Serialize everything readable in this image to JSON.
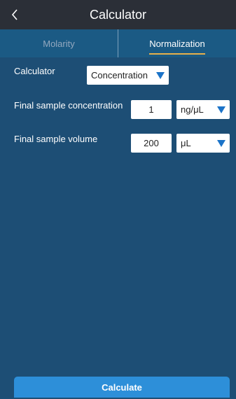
{
  "header": {
    "title": "Calculator",
    "back_icon": "chevron-left-icon"
  },
  "tabs": [
    {
      "label": "Molarity",
      "active": false
    },
    {
      "label": "Normalization",
      "active": true
    }
  ],
  "form": {
    "calculator": {
      "label": "Calculator",
      "selected": "Concentration"
    },
    "concentration": {
      "label": "Final sample concentration",
      "value": "1",
      "unit": "ng/μL"
    },
    "volume": {
      "label": "Final sample volume",
      "value": "200",
      "unit": "μL"
    }
  },
  "actions": {
    "calculate_label": "Calculate"
  },
  "colors": {
    "background": "#1d4e75",
    "titlebar": "#2b2f37",
    "tabbar": "#1b5a84",
    "accent_underline": "#e8b04a",
    "caret": "#1b73c8",
    "button": "#2d8fd9"
  }
}
